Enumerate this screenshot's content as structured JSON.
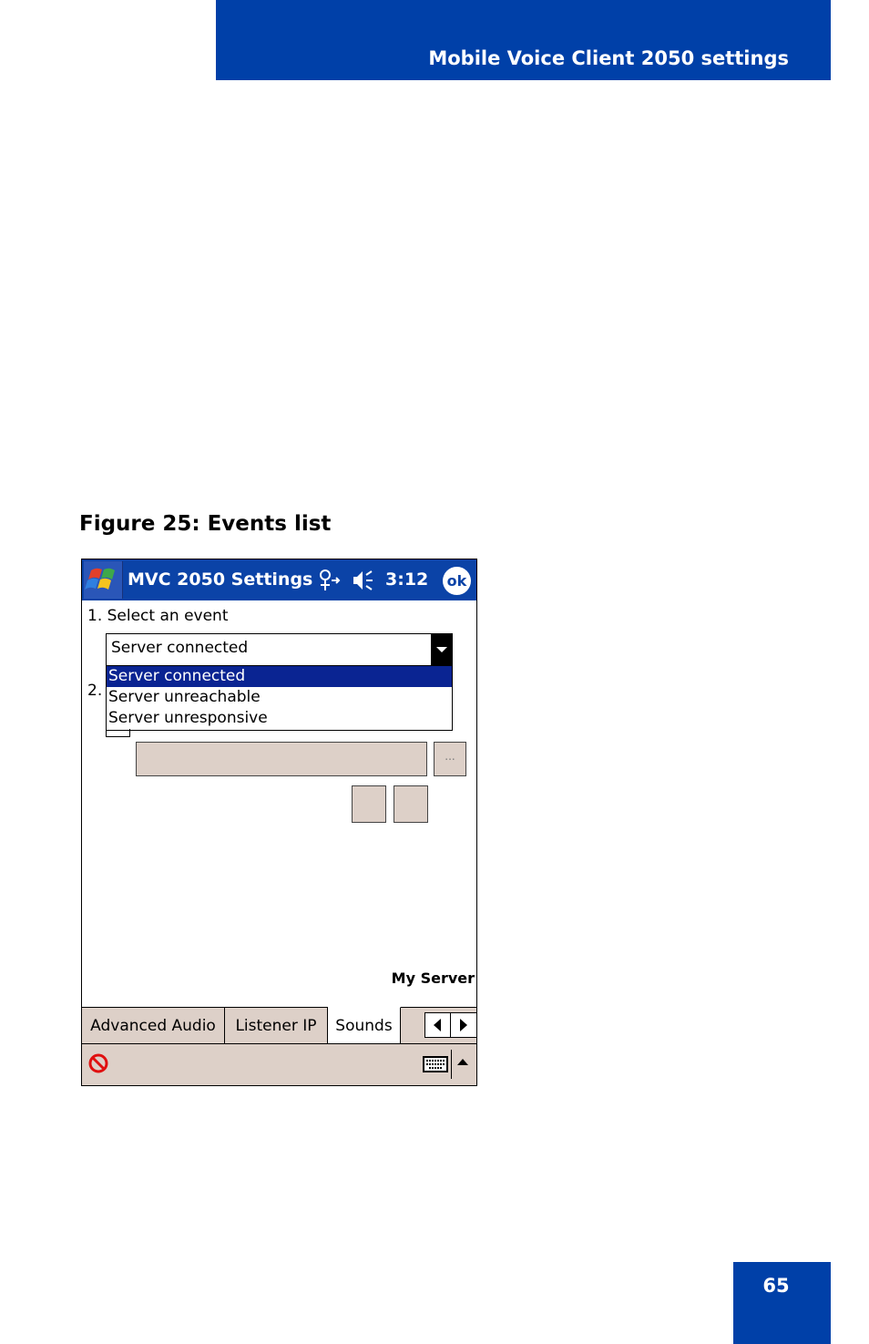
{
  "header": {
    "title": "Mobile Voice Client 2050 settings"
  },
  "figure": {
    "caption": "Figure 25: Events list"
  },
  "device": {
    "titlebar": {
      "title": "MVC 2050 Settings",
      "time": "3:12",
      "ok_label": "ok"
    },
    "step1_label": "1. Select an event",
    "step2_label": "2.",
    "event_select": {
      "selected": "Server connected",
      "options": [
        "Server connected",
        "Server unreachable",
        "Server unresponsive"
      ]
    },
    "browse_label": "...",
    "server_name": "My Server",
    "tabs": [
      "Advanced Audio",
      "Listener IP",
      "Sounds"
    ]
  },
  "colors": {
    "brand_blue": "#0040a8",
    "titlebar_blue": "#0b43a7",
    "selection_blue": "#0a2492",
    "control_beige": "#ddd0c8"
  },
  "page": {
    "number": "65"
  }
}
